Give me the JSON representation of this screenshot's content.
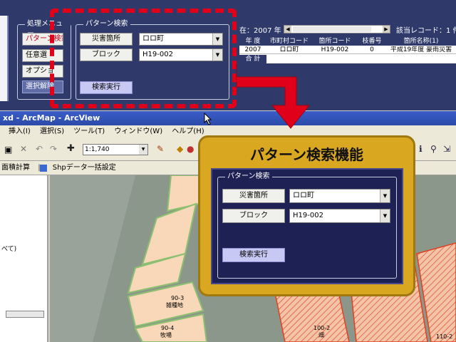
{
  "top": {
    "menu_frame_title": "処理メニュー",
    "menu_buttons": [
      "パターン検索",
      "任意選",
      "オプショ",
      "選択解除"
    ],
    "search_frame_title": "パターン検索",
    "disaster_label": "災害箇所",
    "disaster_value": "ロロ町",
    "block_label": "ブロック",
    "block_value": "H19-002",
    "exec_label": "検索実行",
    "year_text": "在：2007 年",
    "record_text": "該当レコード：1 件",
    "table_headers": [
      "年 度",
      "市町村コード",
      "箇所コード",
      "枝番号",
      "箇所名称(1)"
    ],
    "table_row": [
      "2007",
      "ロロ町",
      "H19-002",
      "0",
      "平成19年度 豪雨災害"
    ],
    "total_label": "合 計"
  },
  "arcmap": {
    "title": "xd - ArcMap - ArcView",
    "menus": [
      "挿入(I)",
      "選択(S)",
      "ツール(T)",
      "ウィンドウ(W)",
      "ヘルプ(H)"
    ],
    "scale": "1:1,740",
    "toolbar2_a": "面積計算",
    "toolbar2_b": "Shpデータ一括設定",
    "toc_text": "べて)",
    "labels": [
      "90-3",
      "雑種地",
      "90-4",
      "牧場",
      "100-2",
      "畑",
      "110-2"
    ]
  },
  "callout": {
    "title": "パターン検索機能",
    "panel_title": "パターン検索",
    "disaster_label": "災害箇所",
    "disaster_value": "ロロ町",
    "block_label": "ブロック",
    "block_value": "H19-002",
    "exec_label": "検索実行"
  },
  "colors": {
    "highlight_red": "#e0001a",
    "callout_gold": "#d9a820",
    "panel_navy": "#2f3a6b"
  }
}
